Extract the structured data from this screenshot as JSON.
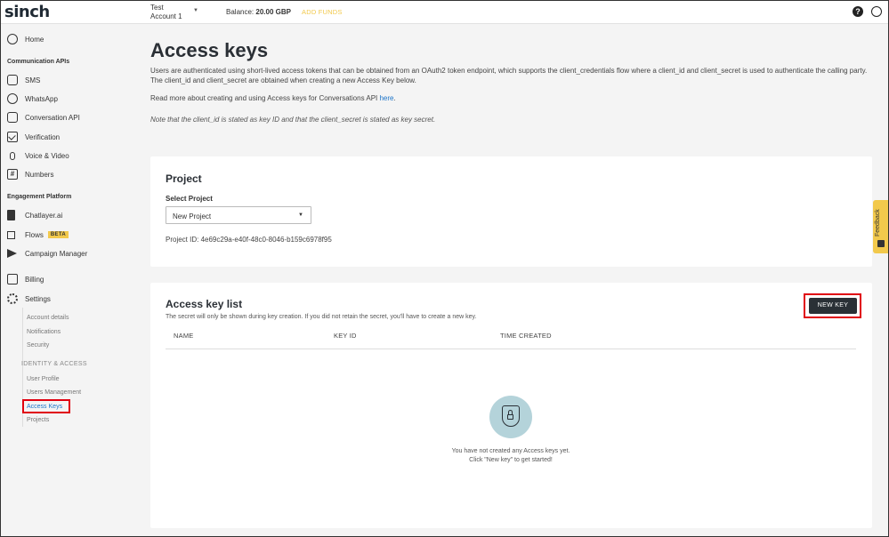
{
  "header": {
    "logo": "sinch",
    "account_line1": "Test",
    "account_line2": "Account 1",
    "balance_label": "Balance:",
    "balance_value": "20.00 GBP",
    "add_funds": "ADD FUNDS"
  },
  "sidebar": {
    "home": "Home",
    "section_comm": "Communication APIs",
    "comm_items": [
      "SMS",
      "WhatsApp",
      "Conversation API",
      "Verification",
      "Voice & Video",
      "Numbers"
    ],
    "section_engage": "Engagement Platform",
    "engage_items": [
      "Chatlayer.ai",
      "Flows",
      "Campaign Manager"
    ],
    "beta_badge": "BETA",
    "billing": "Billing",
    "settings": "Settings",
    "settings_sub": [
      "Account details",
      "Notifications",
      "Security"
    ],
    "identity_heading": "IDENTITY & ACCESS",
    "identity_sub": [
      "User Profile",
      "Users Management",
      "Access Keys",
      "Projects"
    ]
  },
  "main": {
    "title": "Access keys",
    "description": "Users are authenticated using short-lived access tokens that can be obtained from an OAuth2 token endpoint, which supports the client_credentials flow where a client_id and client_secret is used to authenticate the calling party. The client_id and client_secret are obtained when creating a new Access Key below.",
    "read_more_prefix": "Read more about creating and using Access keys for Conversations API ",
    "read_more_link": "here",
    "read_more_suffix": ".",
    "note": "Note that the client_id is stated as key ID and that the client_secret is stated as key secret."
  },
  "project": {
    "title": "Project",
    "select_label": "Select Project",
    "selected": "New Project",
    "project_id": "Project ID: 4e69c29a-e40f-48c0-8046-b159c6978f95"
  },
  "keys": {
    "title": "Access key list",
    "description": "The secret will only be shown during key creation. If you did not retain the secret, you'll have to create a new key.",
    "new_key": "NEW KEY",
    "columns": [
      "NAME",
      "KEY ID",
      "TIME CREATED"
    ],
    "empty_line1": "You have not created any Access keys yet.",
    "empty_line2": "Click \"New key\" to get started!"
  },
  "feedback": "Feedback",
  "icons": {
    "help": "help-icon",
    "user": "user-account-icon"
  },
  "colors": {
    "accent_yellow": "#f2c94c",
    "highlight_red": "#e0000f",
    "link_blue": "#1a73c8",
    "dark_button": "#2a3036"
  }
}
